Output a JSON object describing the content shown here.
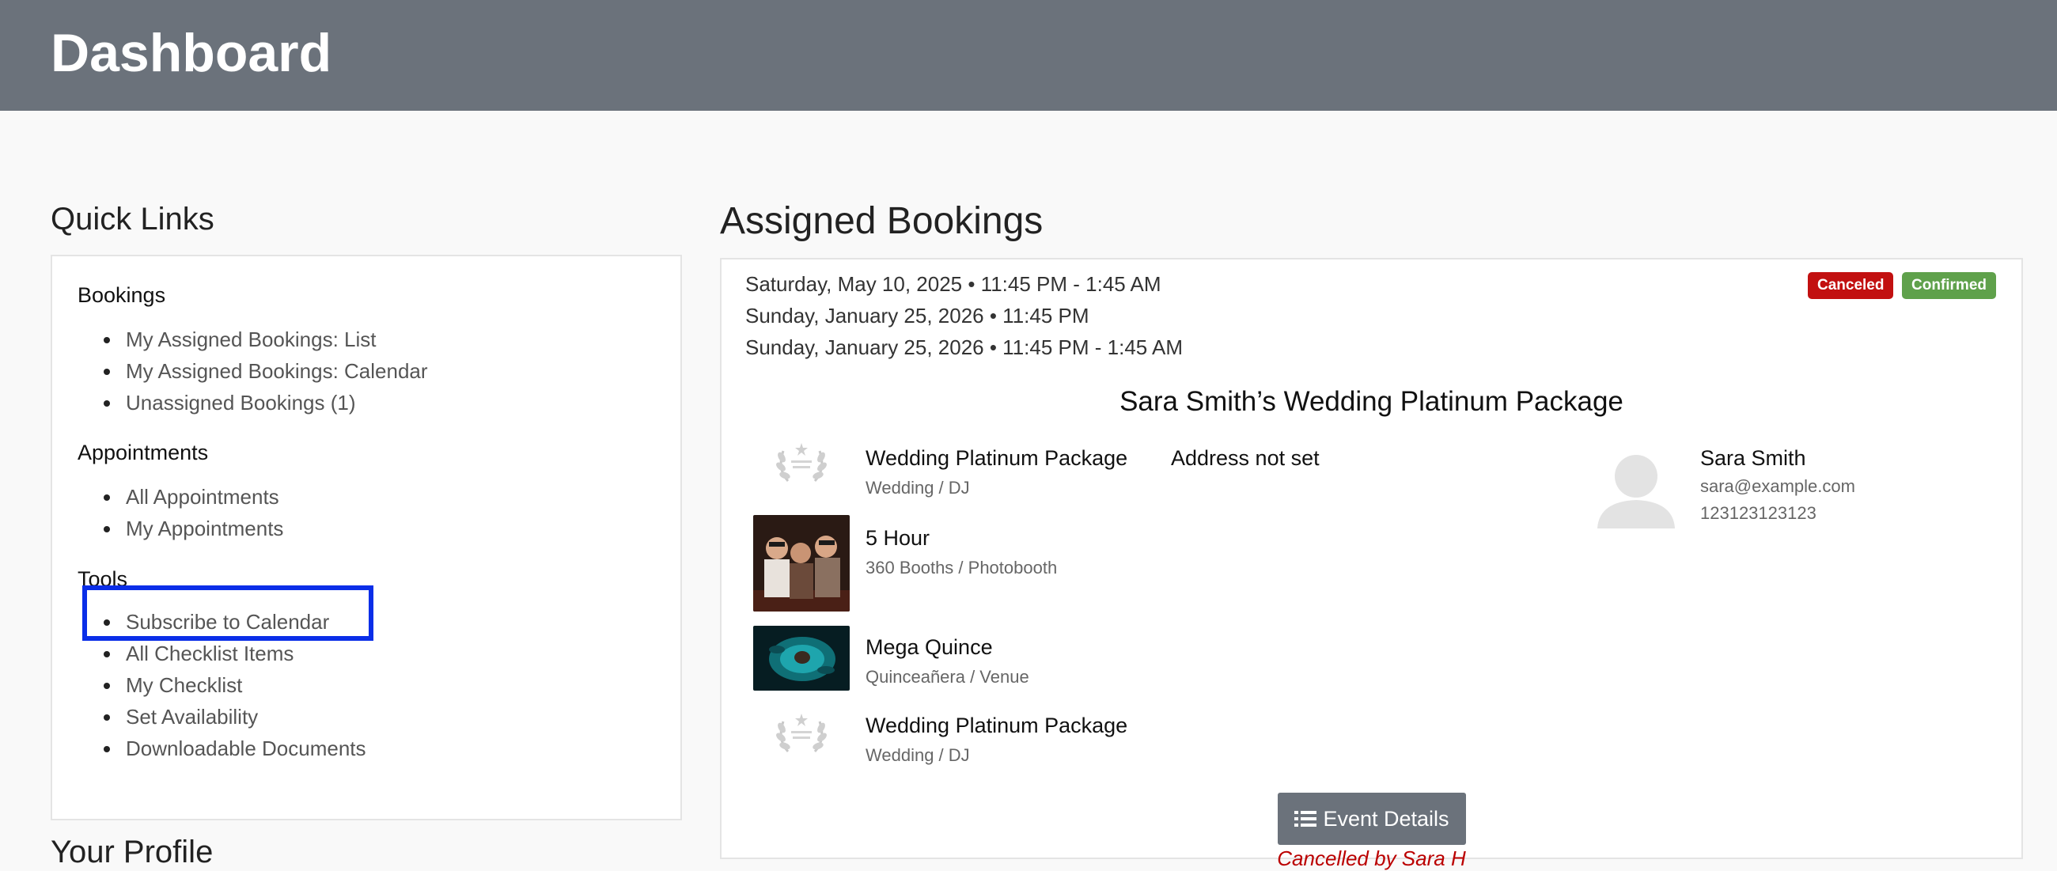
{
  "header": {
    "title": "Dashboard"
  },
  "quick_links": {
    "title": "Quick Links",
    "groups": [
      {
        "title": "Bookings",
        "items": [
          "My Assigned Bookings: List",
          "My Assigned Bookings: Calendar",
          "Unassigned Bookings (1)"
        ]
      },
      {
        "title": "Appointments",
        "items": [
          "All Appointments",
          "My Appointments"
        ]
      },
      {
        "title": "Tools",
        "items": [
          "Subscribe to Calendar",
          "All Checklist Items",
          "My Checklist",
          "Set Availability",
          "Downloadable Documents"
        ]
      }
    ]
  },
  "profile": {
    "title": "Your Profile"
  },
  "assigned_bookings": {
    "title": "Assigned Bookings",
    "booking": {
      "dates": [
        "Saturday, May 10, 2025 • 11:45 PM - 1:45 AM",
        "Sunday, January 25, 2026 • 11:45 PM",
        "Sunday, January 25, 2026 • 11:45 PM - 1:45 AM"
      ],
      "badges": {
        "canceled": "Canceled",
        "confirmed": "Confirmed"
      },
      "event_title": "Sara Smith’s Wedding Platinum Package",
      "items": [
        {
          "name": "Wedding Platinum Package",
          "sub": "Wedding / DJ",
          "thumb_icon": "laurel-package-icon"
        },
        {
          "name": "5 Hour",
          "sub": "360 Booths / Photobooth",
          "thumb_icon": "photobooth-photo"
        },
        {
          "name": "Mega Quince",
          "sub": "Quinceañera / Venue",
          "thumb_icon": "quince-photo"
        },
        {
          "name": "Wedding Platinum Package",
          "sub": "Wedding / DJ",
          "thumb_icon": "laurel-package-icon"
        }
      ],
      "address": "Address not set",
      "client": {
        "name": "Sara Smith",
        "email": "sara@example.com",
        "phone": "123123123123",
        "avatar_icon": "user-avatar-icon"
      },
      "details_button": "Event Details",
      "cancel_note": "Cancelled by Sara H"
    }
  }
}
